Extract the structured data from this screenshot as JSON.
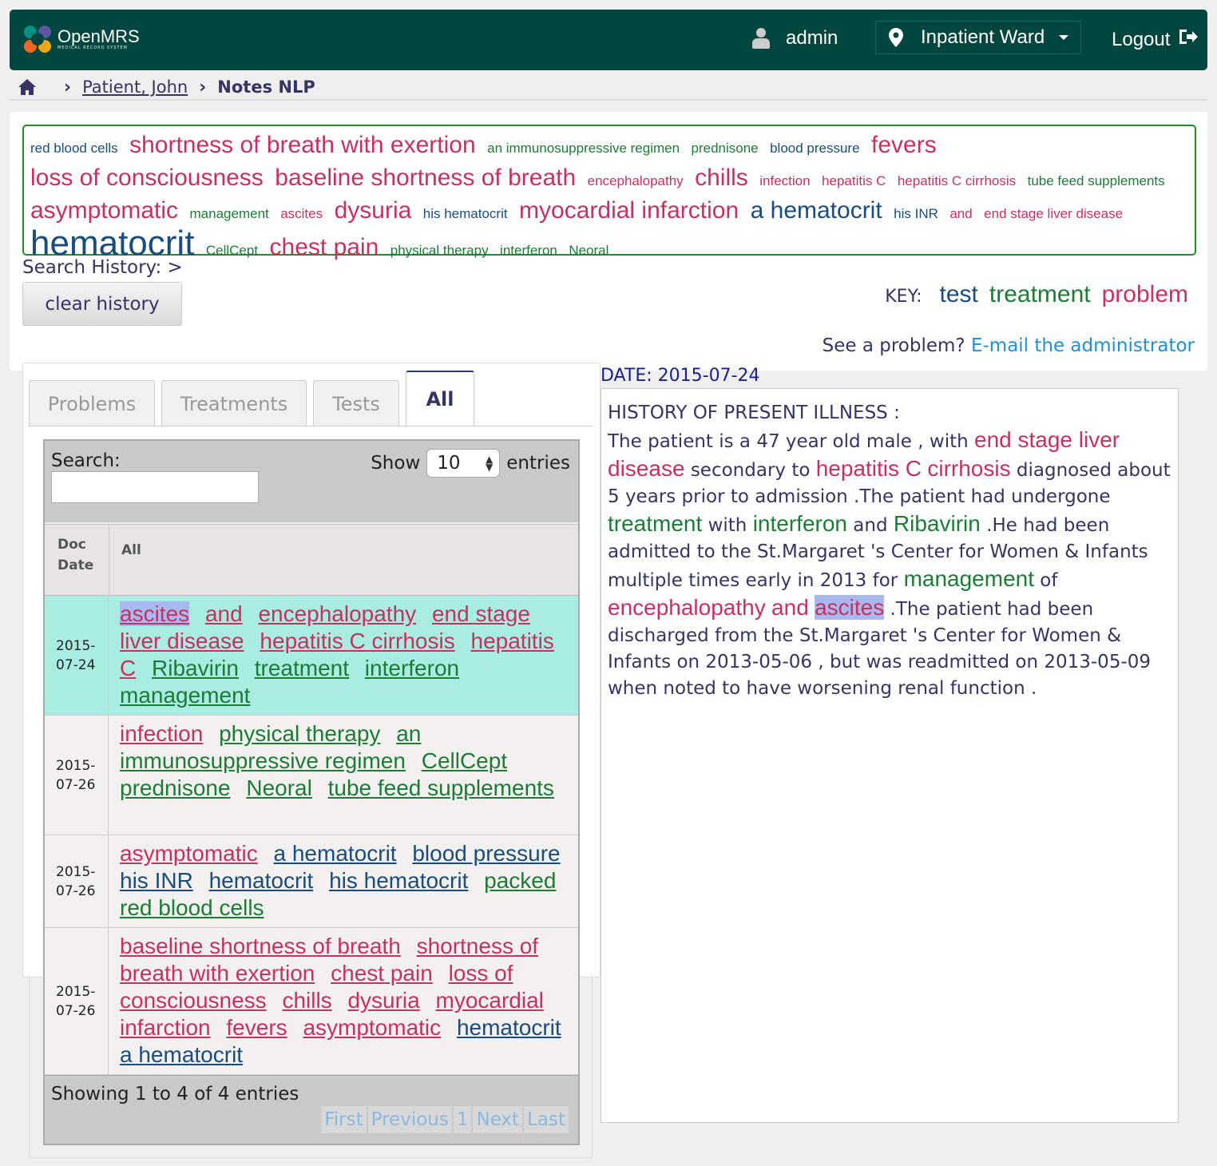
{
  "header": {
    "logo_name": "OpenMRS",
    "logo_sub": "MEDICAL RECORD SYSTEM",
    "user": "admin",
    "location": "Inpatient Ward",
    "logout": "Logout"
  },
  "breadcrumb": {
    "patient": "Patient, John",
    "current": "Notes NLP"
  },
  "cloud": [
    {
      "text": "red blood cells",
      "type": "test",
      "size": 17
    },
    {
      "text": "shortness of breath with exertion",
      "type": "problem",
      "size": 30
    },
    {
      "text": "an immunosuppressive regimen",
      "type": "treatment",
      "size": 17
    },
    {
      "text": "prednisone",
      "type": "treatment",
      "size": 17
    },
    {
      "text": "blood pressure",
      "type": "test",
      "size": 17
    },
    {
      "text": "fevers",
      "type": "problem",
      "size": 30
    },
    {
      "text": "loss of consciousness",
      "type": "problem",
      "size": 30
    },
    {
      "text": "baseline shortness of breath",
      "type": "problem",
      "size": 30
    },
    {
      "text": "encephalopathy",
      "type": "problem",
      "size": 17
    },
    {
      "text": "chills",
      "type": "problem",
      "size": 30
    },
    {
      "text": "infection",
      "type": "problem",
      "size": 17
    },
    {
      "text": "hepatitis C",
      "type": "problem",
      "size": 17
    },
    {
      "text": "hepatitis C cirrhosis",
      "type": "problem",
      "size": 17
    },
    {
      "text": "tube feed supplements",
      "type": "treatment",
      "size": 17
    },
    {
      "text": "asymptomatic",
      "type": "problem",
      "size": 30
    },
    {
      "text": "management",
      "type": "treatment",
      "size": 17
    },
    {
      "text": "ascites",
      "type": "problem",
      "size": 17
    },
    {
      "text": "dysuria",
      "type": "problem",
      "size": 30
    },
    {
      "text": "his hematocrit",
      "type": "test",
      "size": 17
    },
    {
      "text": "myocardial infarction",
      "type": "problem",
      "size": 30
    },
    {
      "text": "a hematocrit",
      "type": "test",
      "size": 30
    },
    {
      "text": "his INR",
      "type": "test",
      "size": 17
    },
    {
      "text": "and",
      "type": "problem",
      "size": 17
    },
    {
      "text": "end stage liver disease",
      "type": "problem",
      "size": 17
    },
    {
      "text": "hematocrit",
      "type": "test",
      "size": 44
    },
    {
      "text": "CellCept",
      "type": "treatment",
      "size": 17
    },
    {
      "text": "chest pain",
      "type": "problem",
      "size": 30
    },
    {
      "text": "physical therapy",
      "type": "treatment",
      "size": 17
    },
    {
      "text": "interferon",
      "type": "treatment",
      "size": 17
    },
    {
      "text": "Neoral",
      "type": "treatment",
      "size": 17
    }
  ],
  "search_history": {
    "label": "Search History:",
    "arrow": ">"
  },
  "clear_history": "clear history",
  "key": {
    "label": "KEY:",
    "test": "test",
    "treatment": "treatment",
    "problem": "problem"
  },
  "see_problem": {
    "text": "See a problem?",
    "link": "E-mail the administrator"
  },
  "tabs": [
    "Problems",
    "Treatments",
    "Tests",
    "All"
  ],
  "active_tab": "All",
  "table": {
    "search_label": "Search:",
    "search_value": "",
    "show_label": "Show",
    "show_value": "10",
    "entries_label": "entries",
    "col_date": "Doc Date",
    "col_all": "All",
    "rows": [
      {
        "date": "2015-07-24",
        "selected": true,
        "terms": [
          {
            "text": "ascites",
            "type": "problem",
            "highlight": true
          },
          {
            "text": "and",
            "type": "problem"
          },
          {
            "text": "encephalopathy",
            "type": "problem"
          },
          {
            "text": "end stage liver disease",
            "type": "problem"
          },
          {
            "text": "hepatitis C cirrhosis",
            "type": "problem"
          },
          {
            "text": "hepatitis C",
            "type": "problem"
          },
          {
            "text": "Ribavirin",
            "type": "treatment"
          },
          {
            "text": "treatment",
            "type": "treatment"
          },
          {
            "text": "interferon",
            "type": "treatment"
          },
          {
            "text": "management",
            "type": "treatment"
          }
        ]
      },
      {
        "date": "2015-07-26",
        "selected": false,
        "terms": [
          {
            "text": "infection",
            "type": "problem"
          },
          {
            "text": "physical therapy",
            "type": "treatment"
          },
          {
            "text": "an immunosuppressive regimen",
            "type": "treatment"
          },
          {
            "text": "CellCept",
            "type": "treatment"
          },
          {
            "text": "prednisone",
            "type": "treatment"
          },
          {
            "text": "Neoral",
            "type": "treatment"
          },
          {
            "text": "tube feed supplements",
            "type": "treatment"
          }
        ]
      },
      {
        "date": "2015-07-26",
        "selected": false,
        "terms": [
          {
            "text": "asymptomatic",
            "type": "problem"
          },
          {
            "text": "a hematocrit",
            "type": "test"
          },
          {
            "text": "blood pressure",
            "type": "test"
          },
          {
            "text": "his INR",
            "type": "test"
          },
          {
            "text": "hematocrit",
            "type": "test"
          },
          {
            "text": "his hematocrit",
            "type": "test"
          },
          {
            "text": "packed red blood cells",
            "type": "treatment"
          }
        ]
      },
      {
        "date": "2015-07-26",
        "selected": false,
        "terms": [
          {
            "text": "baseline shortness of breath",
            "type": "problem"
          },
          {
            "text": "shortness of breath with exertion",
            "type": "problem"
          },
          {
            "text": "chest pain",
            "type": "problem"
          },
          {
            "text": "loss of consciousness",
            "type": "problem"
          },
          {
            "text": "chills",
            "type": "problem"
          },
          {
            "text": "dysuria",
            "type": "problem"
          },
          {
            "text": "myocardial infarction",
            "type": "problem"
          },
          {
            "text": "fevers",
            "type": "problem"
          },
          {
            "text": "asymptomatic",
            "type": "problem"
          },
          {
            "text": "hematocrit",
            "type": "test"
          },
          {
            "text": "a hematocrit",
            "type": "test"
          }
        ]
      }
    ],
    "info": "Showing 1 to 4 of 4 entries",
    "pager": [
      "First",
      "Previous",
      "1",
      "Next",
      "Last"
    ]
  },
  "note": {
    "date_label": "DATE: 2015-07-24",
    "segments": [
      {
        "text": "HISTORY OF PRESENT ILLNESS :",
        "br": true
      },
      {
        "text": "The patient is a 47 year old male , with "
      },
      {
        "text": "end stage liver disease",
        "type": "problem"
      },
      {
        "text": " secondary to "
      },
      {
        "text": "hepatitis C",
        "type": "problem"
      },
      {
        "text": " "
      },
      {
        "text": "cirrhosis",
        "type": "problem"
      },
      {
        "text": " diagnosed about 5 years prior to admission .The patient had undergone "
      },
      {
        "text": "treatment",
        "type": "treatment"
      },
      {
        "text": " with "
      },
      {
        "text": "interferon",
        "type": "treatment"
      },
      {
        "text": " and "
      },
      {
        "text": "Ribavirin",
        "type": "treatment"
      },
      {
        "text": " .He had been admitted to the St.Margaret 's Center for Women & Infants multiple times early in 2013 for "
      },
      {
        "text": "management",
        "type": "treatment"
      },
      {
        "text": " of "
      },
      {
        "text": "encephalopathy",
        "type": "problem"
      },
      {
        "text": " "
      },
      {
        "text": "and",
        "type": "problem"
      },
      {
        "text": " "
      },
      {
        "text": "ascites",
        "type": "problem",
        "highlight": true
      },
      {
        "text": " .The patient had been discharged from the St.Margaret 's Center for Women & Infants on 2013-05-06 , but was readmitted on 2013-05-09 when noted to have worsening renal function ."
      }
    ]
  }
}
